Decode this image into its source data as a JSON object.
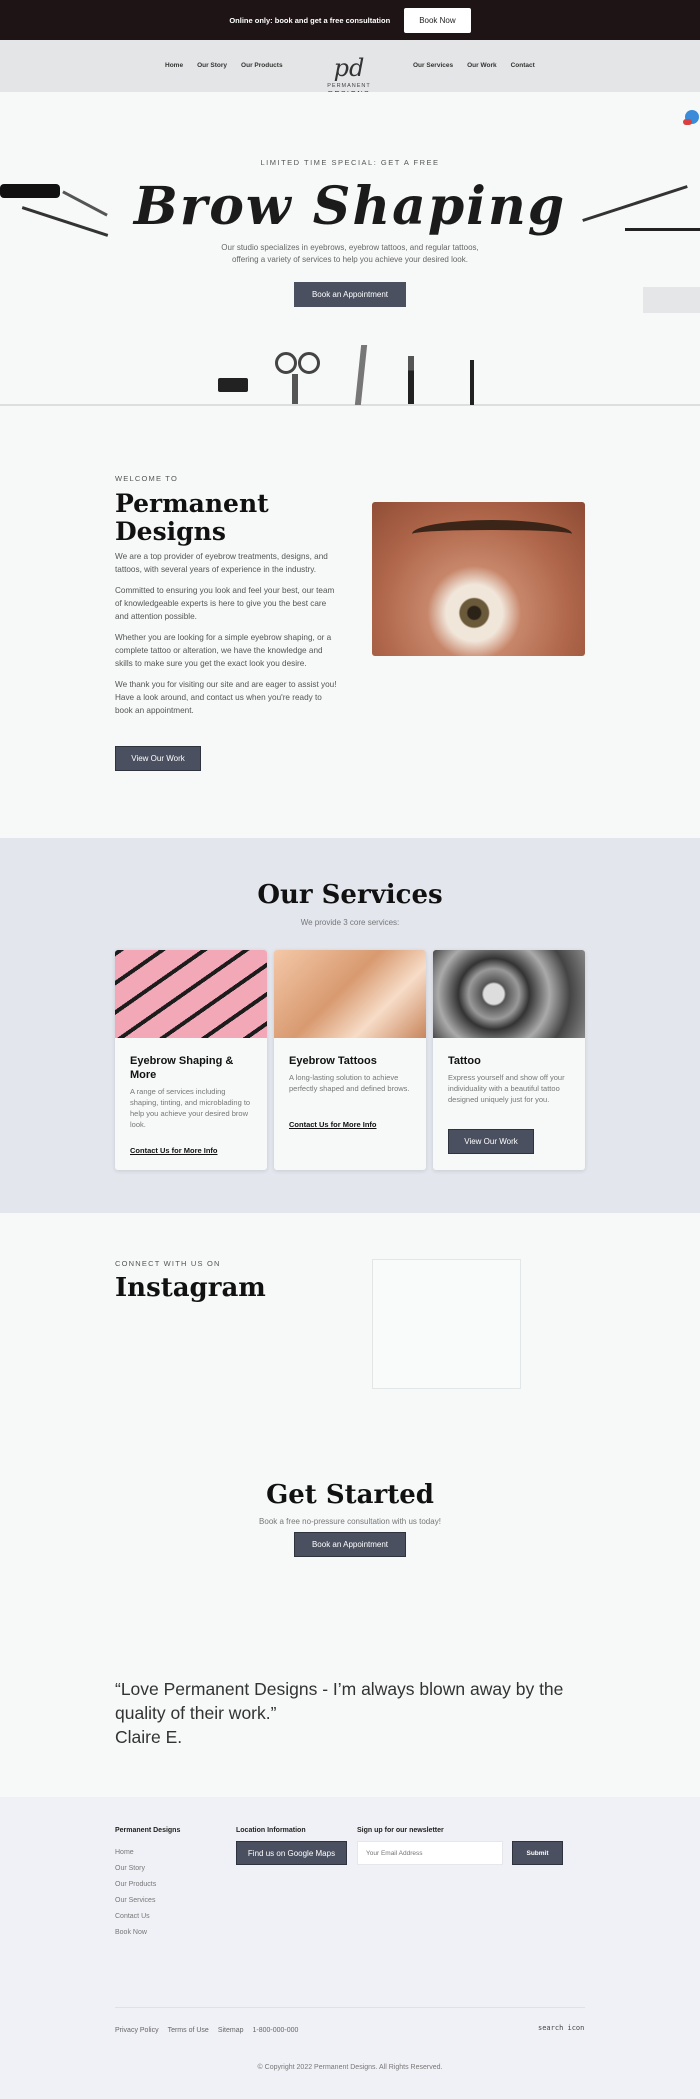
{
  "announcement": {
    "text": "Online only: book and get a free consultation",
    "button": "Book Now"
  },
  "nav": {
    "left": [
      "Home",
      "Our Story",
      "Our Products"
    ],
    "right": [
      "Our Services",
      "Our Work",
      "Contact"
    ],
    "logo_mark": "pd",
    "logo_line1": "PERMANENT",
    "logo_line2": "DESIGNS"
  },
  "hero": {
    "kicker": "LIMITED TIME SPECIAL: GET A FREE",
    "title": "Brow Shaping",
    "description": "Our studio specializes in eyebrows, eyebrow tattoos, and regular tattoos, offering a variety of services to help you achieve your desired look.",
    "button": "Book an Appointment"
  },
  "about": {
    "kicker": "WELCOME TO",
    "title": "Permanent Designs",
    "paragraphs": [
      "We are a top provider of eyebrow treatments, designs, and tattoos, with several years of experience in the industry.",
      "Committed to ensuring you look and feel your best, our team of knowledgeable experts is here to give you the best care and attention possible.",
      "Whether you are looking for a simple eyebrow shaping, or a complete tattoo or alteration, we have the knowledge and skills to make sure you get the exact look you desire.",
      "We thank you for visiting our site and are eager to assist you! Have a look around, and contact us when you're ready to book an appointment."
    ],
    "button": "View Our Work"
  },
  "services": {
    "title": "Our Services",
    "subtitle": "We provide 3 core services:",
    "cards": [
      {
        "title": "Eyebrow Shaping & More",
        "description": "A range of services including shaping, tinting, and microblading to help you achieve your desired brow look.",
        "link": "Contact Us for More Info"
      },
      {
        "title": "Eyebrow Tattoos",
        "description": "A long-lasting solution to achieve perfectly shaped and defined brows.",
        "link": "Contact Us for More Info"
      },
      {
        "title": "Tattoo",
        "description": "Express yourself and show off your individuality with a beautiful tattoo designed uniquely just for you.",
        "button": "View Our Work"
      }
    ]
  },
  "instagram": {
    "kicker": "CONNECT WITH US ON",
    "title": "Instagram"
  },
  "get_started": {
    "title": "Get Started",
    "subtitle": "Book a free no-pressure consultation with us today!",
    "button": "Book an Appointment"
  },
  "testimonial": {
    "quote": "“Love Permanent Designs - I’m always blown away by the quality of their work.”",
    "author": "Claire E."
  },
  "footer": {
    "brand": "Permanent Designs",
    "links": [
      "Home",
      "Our Story",
      "Our Products",
      "Our Services",
      "Contact Us",
      "Book Now"
    ],
    "location_heading": "Location Information",
    "maps_button": "Find us on Google Maps",
    "newsletter_heading": "Sign up for our newsletter",
    "email_placeholder": "Your Email Address",
    "submit": "Submit",
    "bottom_links": [
      "Privacy Policy",
      "Terms of Use",
      "Sitemap",
      "1-800-000-000"
    ],
    "search_label": "search icon",
    "copyright": "© Copyright 2022 Permanent Designs. All Rights Reserved."
  },
  "colors": {
    "announcement_bg": "#1e1416",
    "button_dark": "#4a5060",
    "services_bg": "#e4e6ee"
  }
}
